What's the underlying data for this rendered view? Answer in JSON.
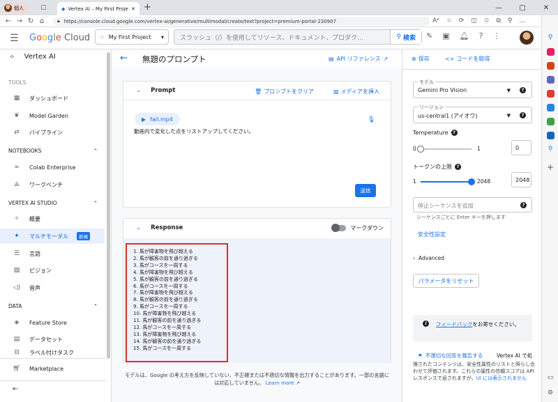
{
  "browser": {
    "profile_label": "個人",
    "tab_title": "Vertex AI – My First Project – Go",
    "url": "https://console.cloud.google.com/vertex-ai/generative/multimodal/create/text?project=premium-portal-230907"
  },
  "header": {
    "logo_google": "Google",
    "logo_cloud": "Cloud",
    "project": "My First Project",
    "search_placeholder": "スラッシュ（/）を使用してリソース、ドキュメント、プロダク...",
    "search_button": "検索"
  },
  "leftnav": {
    "product": "Vertex AI",
    "sections": {
      "tools": "TOOLS",
      "notebooks": "NOTEBOOKS",
      "studio": "VERTEX AI STUDIO",
      "data": "DATA"
    },
    "items": {
      "dashboard": "ダッシュボード",
      "model_garden": "Model Garden",
      "pipelines": "パイプライン",
      "colab": "Colab Enterprise",
      "workbench": "ワークベンチ",
      "overview": "概要",
      "multimodal": "マルチモーダル",
      "new_badge": "新規",
      "language": "言語",
      "vision": "ビジョン",
      "speech": "音声",
      "feature_store": "Feature Store",
      "datasets": "データセット",
      "labeling": "ラベル付けタスク",
      "marketplace": "Marketplace"
    }
  },
  "main": {
    "title": "無題のプロンプト",
    "api_reference": "API リファレンス",
    "prompt_header": "Prompt",
    "clear_prompt": "プロンプトをクリア",
    "insert_media": "メディアを挿入",
    "media_file": "fail.mp4",
    "prompt_text": "動画内で変化した点をリストアップしてください。",
    "send_button": "送信",
    "response_header": "Response",
    "markdown_toggle": "マークダウン",
    "response_lines": [
      "1. 馬が障害物を飛び越える",
      "2. 馬が観客の前を通り過ぎる",
      "3. 馬がコースを一周する",
      "4. 馬が障害物を飛び越える",
      "5. 馬が観客の前を通り過ぎる",
      "6. 馬がコースを一周する",
      "7. 馬が障害物を飛び越える",
      "8. 馬が観客の前を通り過ぎる",
      "9. 馬がコースを一周する",
      "10. 馬が障害物を飛び越える",
      "11. 馬が観客の前を通り過ぎる",
      "12. 馬がコースを一周する",
      "13. 馬が障害物を飛び越える",
      "14. 馬が観客の前を通り過ぎる",
      "15. 馬がコースを一周する"
    ],
    "footer_text": "モデルは、Google の考え方を反映していない、不正確または不適切な情報を出力することがあります。一部の言語には対応していません。",
    "footer_link": "Learn more"
  },
  "panel": {
    "save": "保存",
    "get_code": "コードを取得",
    "model_label": "モデル",
    "model_value": "Gemini Pro Vision",
    "region_label": "リージョン",
    "region_value": "us-central1 (アイオワ)",
    "temperature_label": "Temperature",
    "temperature_min": "0",
    "temperature_max": "1",
    "temperature_value": "0",
    "temperature_level": 0,
    "token_label": "トークンの上限",
    "token_min": "1",
    "token_max": "2048",
    "token_value": "2048",
    "token_level": 1,
    "stop_placeholder": "停止シーケンスを追加",
    "stop_hint": "シーケンスごとに Enter キーを押します",
    "safety": "安全性設定",
    "advanced": "Advanced",
    "reset": "パラメータをリセット",
    "feedback_link": "フィードバック",
    "feedback_text": "をお寄せください。",
    "report": "不適切な回答を報告する",
    "vertex_note": "Vertex AI で処",
    "bottom_note": "理されたコンテンツは、安全性属性のリストと照らし合わせて評価されます。これらの属性の信頼スコアは API レスポンスで返されますが、",
    "bottom_link": "UI には表示されません"
  },
  "colors": {
    "accent": "#1a73e8",
    "highlight_border": "#d93025",
    "response_bg": "#eef2fb"
  }
}
